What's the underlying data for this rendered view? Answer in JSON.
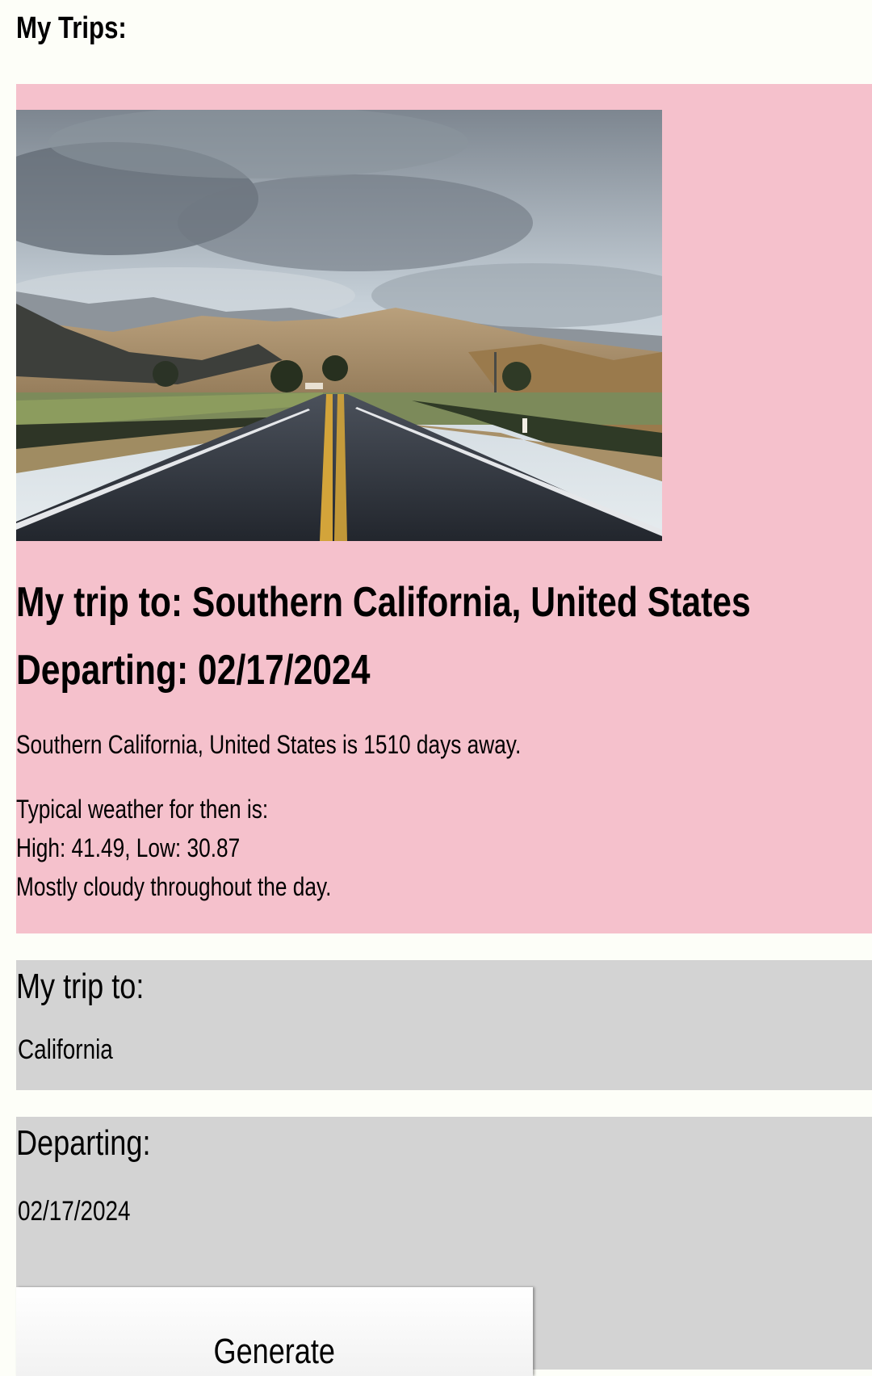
{
  "page": {
    "title": "My Trips:"
  },
  "trip": {
    "destination_heading": "My trip to: Southern California, United States",
    "departing_heading": "Departing: 02/17/2024",
    "countdown": "Southern California, United States is 1510 days away.",
    "weather_intro": "Typical weather for then is:",
    "weather_temps": "High: 41.49, Low: 30.87",
    "weather_summary": "Mostly cloudy throughout the day.",
    "photo": "road-landscape-photo"
  },
  "form": {
    "destination_label": "My trip to:",
    "destination_value": "California",
    "date_label": "Departing:",
    "date_value": "02/17/2024",
    "generate_label": "Generate"
  },
  "colors": {
    "page_background": "#fdfef8",
    "trip_card": "#f5c1cc",
    "form_box": "#d3d3d3"
  }
}
